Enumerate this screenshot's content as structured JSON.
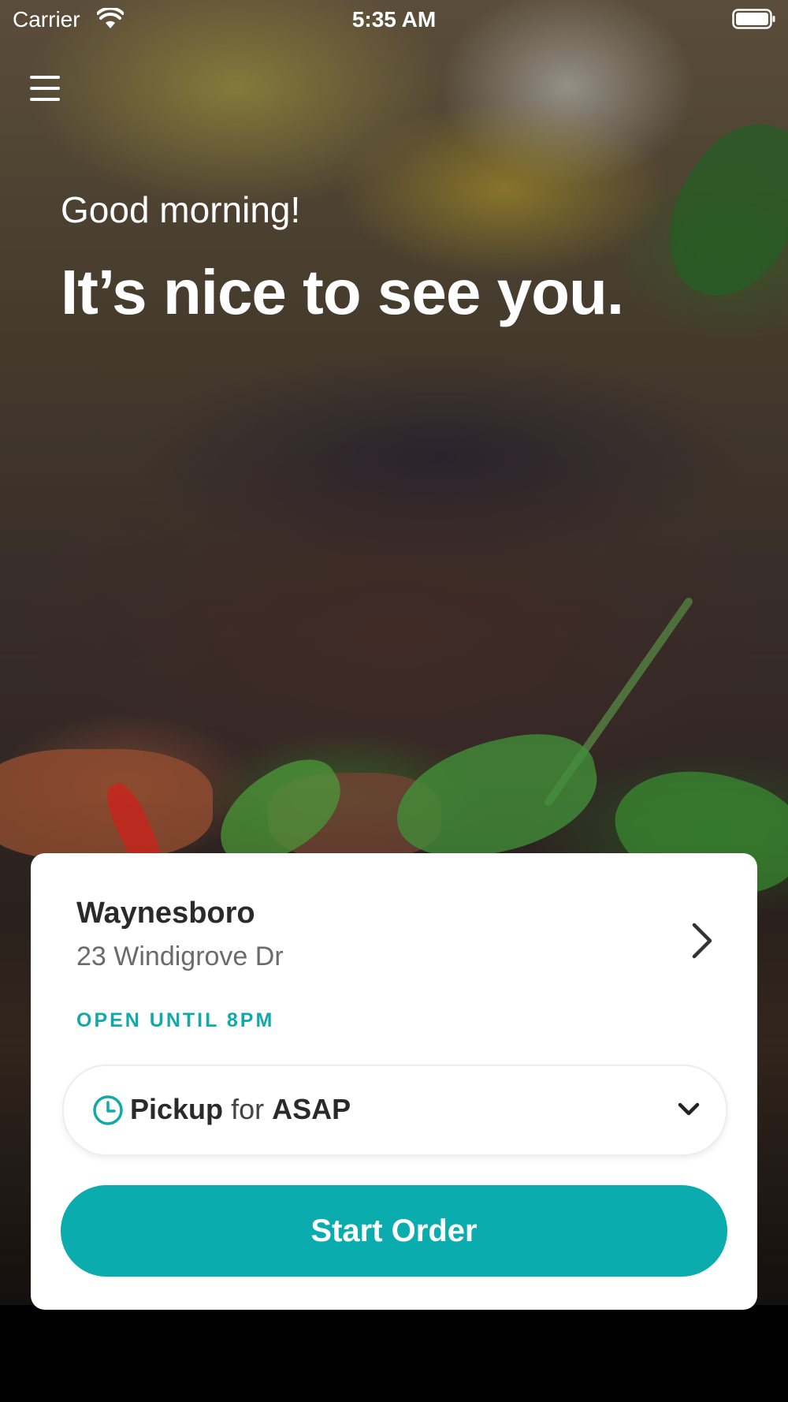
{
  "status_bar": {
    "carrier": "Carrier",
    "time": "5:35 AM",
    "icons": [
      "wifi-icon",
      "battery-icon"
    ]
  },
  "header": {
    "menu_icon": "hamburger-menu-icon"
  },
  "greeting": {
    "subtitle": "Good morning!",
    "title": "It’s nice to see you."
  },
  "location_card": {
    "name": "Waynesboro",
    "address": "23 Windigrove Dr",
    "hours": "OPEN UNTIL 8PM",
    "detail_icon": "chevron-right-icon"
  },
  "order_mode": {
    "mode": "Pickup",
    "connector": "for",
    "time": "ASAP",
    "icon": "clock-icon",
    "dropdown_icon": "chevron-down-icon"
  },
  "actions": {
    "start_order": "Start Order"
  },
  "colors": {
    "accent": "#0aacae",
    "hours_text": "#11a9a9",
    "card_background": "#ffffff",
    "primary_text": "#2a2a2a",
    "secondary_text": "#6b6b6b"
  }
}
